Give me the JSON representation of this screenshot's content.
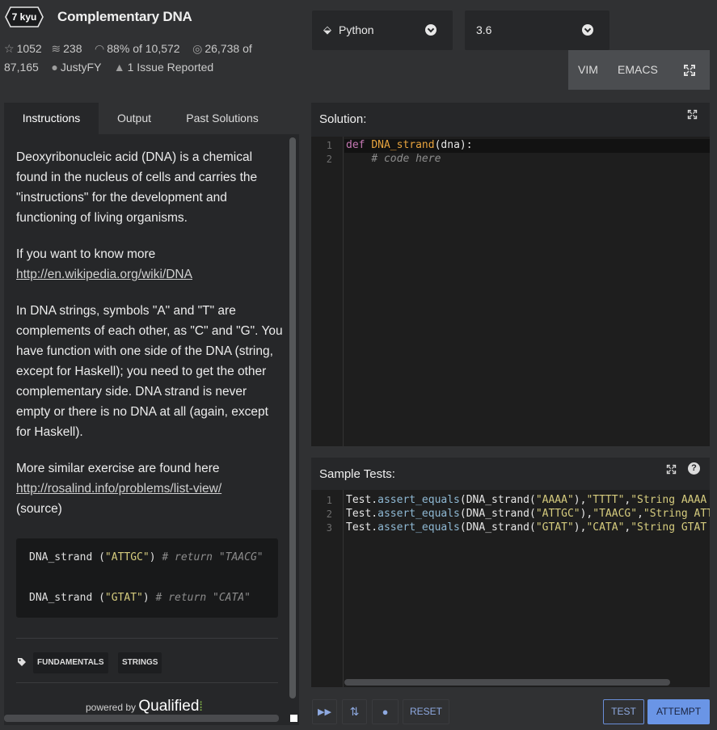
{
  "kata": {
    "rank": "7 kyu",
    "title": "Complementary DNA"
  },
  "stats": {
    "stars": "1052",
    "collections": "238",
    "satisfaction_pct": "88%",
    "satisfaction_of": "of 10,572",
    "completed": "26,738",
    "completed_of": "of",
    "total": "87,165",
    "author": "JustyFY",
    "issues": "1 Issue Reported"
  },
  "language_select": {
    "value": "Python"
  },
  "version_select": {
    "value": "3.6"
  },
  "editor_modes": {
    "vim": "VIM",
    "emacs": "EMACS"
  },
  "tabs": {
    "instructions": "Instructions",
    "output": "Output",
    "past_solutions": "Past Solutions"
  },
  "description": {
    "p1": "Deoxyribonucleic acid (DNA) is a chemical found in the nucleus of cells and carries the \"instructions\" for the development and functioning of living organisms.",
    "p2_text": "If you want to know more",
    "p2_link": "http://en.wikipedia.org/wiki/DNA",
    "p3": "In DNA strings, symbols \"A\" and \"T\" are complements of each other, as \"C\" and \"G\". You have function with one side of the DNA (string, except for Haskell); you need to get the other complementary side. DNA strand is never empty or there is no DNA at all (again, except for Haskell).",
    "p4_text": "More similar exercise are found here",
    "p4_link": "http://rosalind.info/problems/list-view/",
    "p4_suffix": "(source)"
  },
  "example_code": {
    "line1_fn": "DNA_strand (",
    "line1_str": "\"ATTGC\"",
    "line1_close": ")",
    "line1_comment": "# return \"TAACG\"",
    "line2_fn": "DNA_strand (",
    "line2_str": "\"GTAT\"",
    "line2_close": ")",
    "line2_comment": "# return \"CATA\""
  },
  "tags": [
    "FUNDAMENTALS",
    "STRINGS"
  ],
  "powered_by": {
    "text": "powered by",
    "brand": "Qualified"
  },
  "solution": {
    "title": "Solution:",
    "line_numbers": [
      "1",
      "2"
    ],
    "l1_kw": "def",
    "l1_fn": "DNA_strand",
    "l1_rest": "(dna):",
    "l2_comment": "# code here"
  },
  "sample_tests": {
    "title": "Sample Tests:",
    "line_numbers": [
      "1",
      "2",
      "3"
    ],
    "lines": [
      {
        "obj": "Test.",
        "meth": "assert_equals",
        "open": "(DNA_strand(",
        "a1": "\"AAAA\"",
        "mid": "),",
        "a2": "\"TTTT\"",
        "comma": ",",
        "a3": "\"String AAAA i"
      },
      {
        "obj": "Test.",
        "meth": "assert_equals",
        "open": "(DNA_strand(",
        "a1": "\"ATTGC\"",
        "mid": "),",
        "a2": "\"TAACG\"",
        "comma": ",",
        "a3": "\"String ATTC"
      },
      {
        "obj": "Test.",
        "meth": "assert_equals",
        "open": "(DNA_strand(",
        "a1": "\"GTAT\"",
        "mid": "),",
        "a2": "\"CATA\"",
        "comma": ",",
        "a3": "\"String GTAT i"
      }
    ]
  },
  "actions": {
    "reset": "RESET",
    "test": "TEST",
    "attempt": "ATTEMPT"
  },
  "colors": {
    "accent": "#6a95e6",
    "background": "#303133",
    "panel": "#262729",
    "editor": "#1e1e1e"
  }
}
